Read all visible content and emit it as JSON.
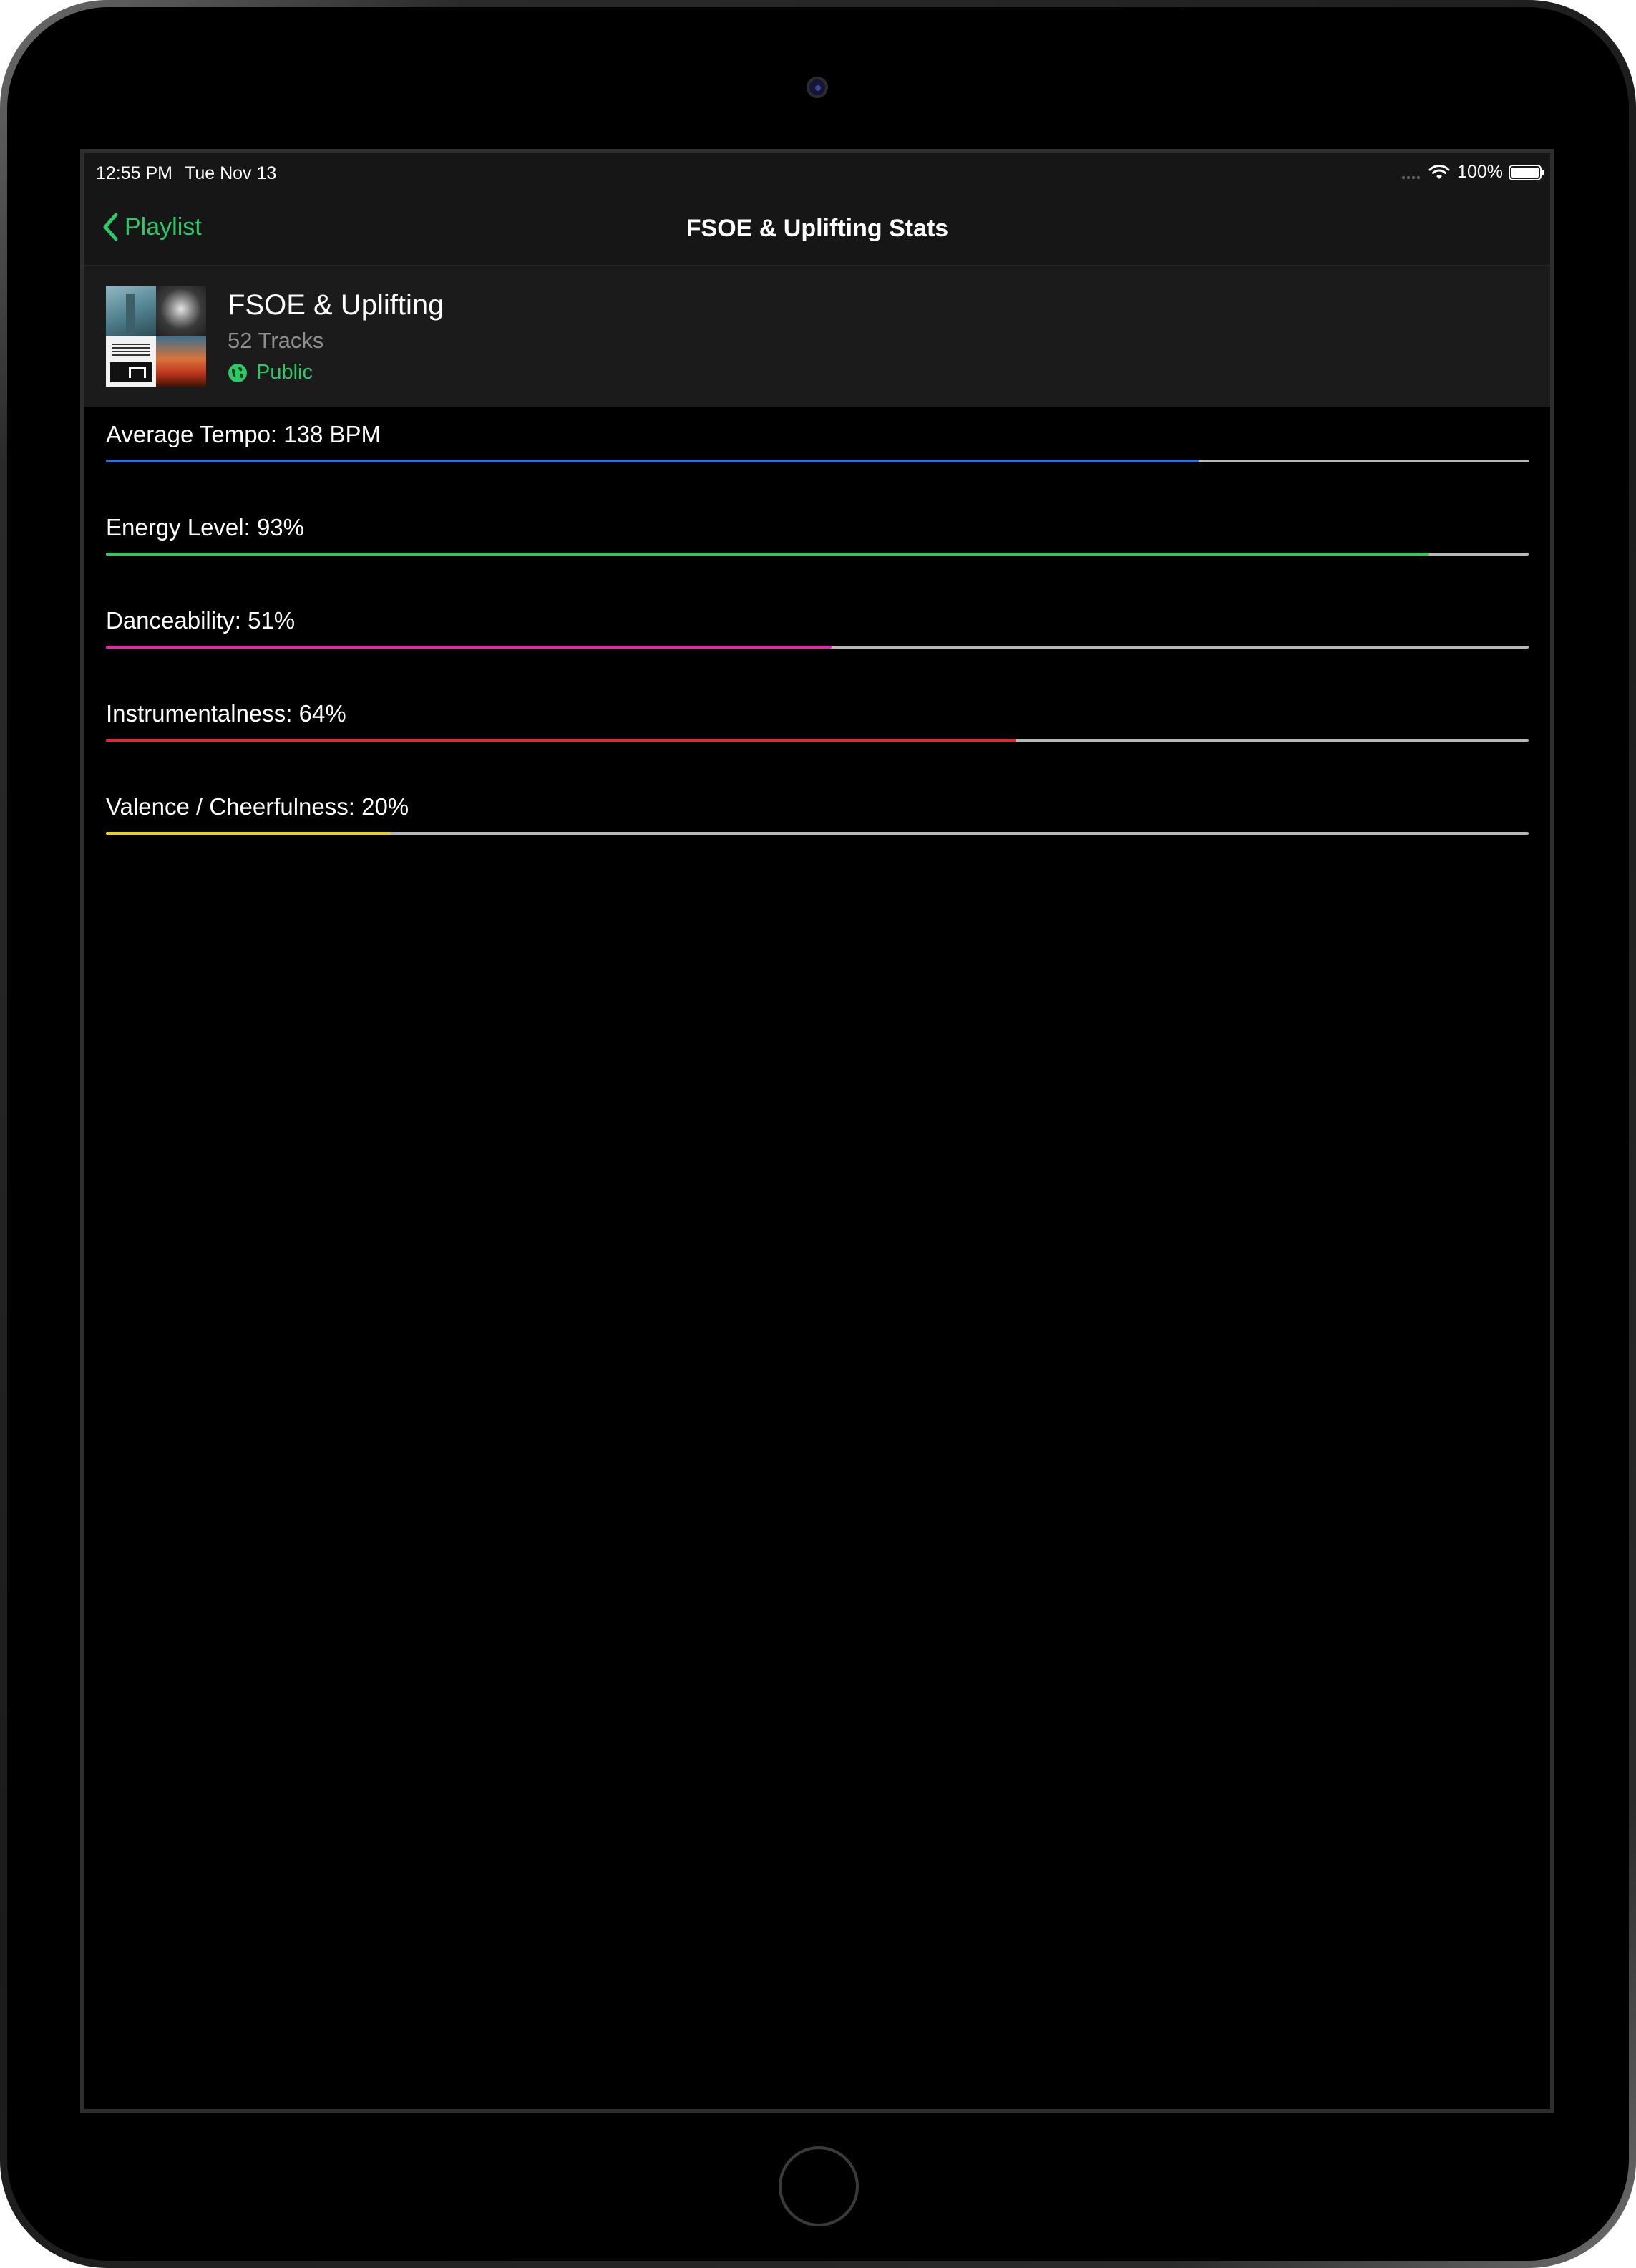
{
  "status_bar": {
    "time": "12:55 PM",
    "date": "Tue Nov 13",
    "battery": "100%",
    "battery_level": 1.0
  },
  "nav": {
    "back_label": "Playlist",
    "title": "FSOE & Uplifting Stats"
  },
  "playlist": {
    "name": "FSOE & Uplifting",
    "tracks": "52 Tracks",
    "visibility": "Public"
  },
  "stats": [
    {
      "label": "Average Tempo: 138 BPM",
      "value": 0.768,
      "color": "#2f6fd6"
    },
    {
      "label": "Energy Level: 93%",
      "value": 0.93,
      "color": "#2ec866"
    },
    {
      "label": "Danceability: 51%",
      "value": 0.51,
      "color": "#e02aa8"
    },
    {
      "label": "Instrumentalness: 64%",
      "value": 0.64,
      "color": "#e0282e"
    },
    {
      "label": "Valence / Cheerfulness: 20%",
      "value": 0.2,
      "color": "#e8d21e"
    }
  ],
  "colors": {
    "accent": "#2ec866",
    "background": "#000000",
    "header_bg": "#1b1b1b"
  }
}
